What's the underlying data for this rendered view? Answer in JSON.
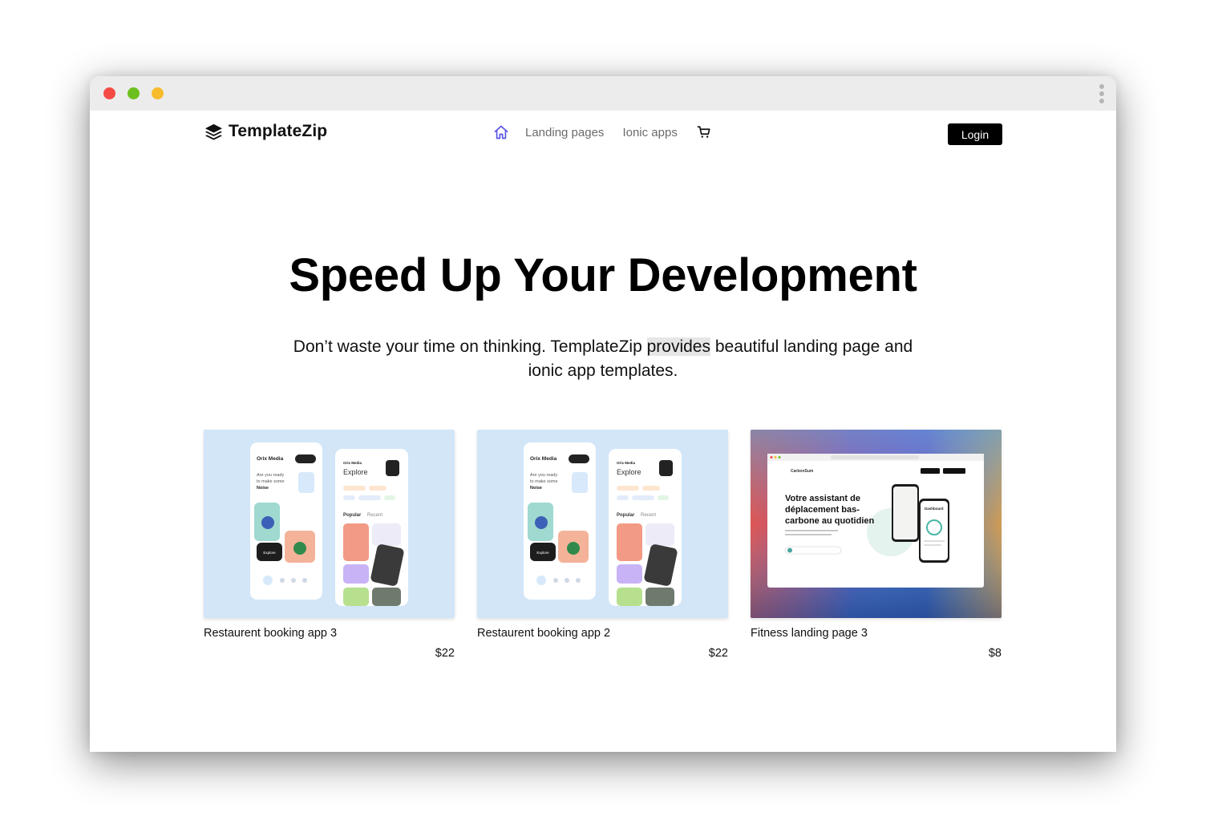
{
  "brand": {
    "name": "TemplateZip"
  },
  "nav": {
    "links": [
      "Landing pages",
      "Ionic apps"
    ],
    "login_label": "Login"
  },
  "hero": {
    "title": "Speed Up Your Development",
    "subtitle_before": "Don’t waste your time on thinking. TemplateZip ",
    "subtitle_highlight": "provides",
    "subtitle_after": " beautiful landing page and ionic app templates."
  },
  "products": [
    {
      "title": "Restaurent booking app 3",
      "price": "$22",
      "preview": {
        "brand": "Orix Media",
        "brand_short": "Orix Media",
        "headline_1": "Are you ready",
        "headline_2": "to make some",
        "headline_3": "Noise",
        "explore": "Explore",
        "popular": "Popular",
        "recent": "Recent"
      }
    },
    {
      "title": "Restaurent booking app 2",
      "price": "$22",
      "preview": {
        "brand": "Orix Media",
        "brand_short": "Orix Media",
        "headline_1": "Are you ready",
        "headline_2": "to make some",
        "headline_3": "Noise",
        "explore": "Explore",
        "popular": "Popular",
        "recent": "Recent"
      }
    },
    {
      "title": "Fitness landing page 3",
      "price": "$8",
      "preview": {
        "site_brand": "CarbonSum",
        "headline_1": "Votre assistant de",
        "headline_2": "déplacement bas-",
        "headline_3": "carbone au quotidien",
        "phone_title": "Dashboard"
      }
    }
  ],
  "colors": {
    "accent": "#5b54e8",
    "card_bg": "#d3e6f8",
    "text": "#111111",
    "muted": "#6b6b6b"
  }
}
